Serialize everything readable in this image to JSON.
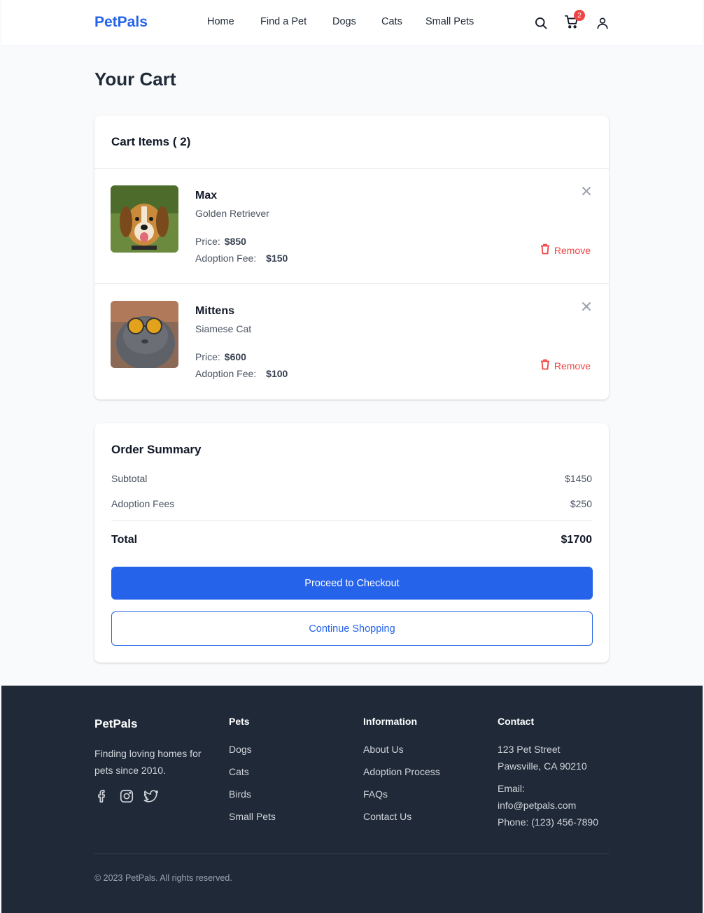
{
  "header": {
    "brand": "PetPals",
    "nav": [
      "Home",
      "Find a Pet",
      "Dogs",
      "Cats",
      "Small Pets"
    ],
    "cart_count": "2",
    "icons": [
      "search-icon",
      "cart-icon",
      "user-icon"
    ]
  },
  "page": {
    "title": "Your Cart"
  },
  "cart": {
    "heading": "Cart Items (  2)",
    "items": [
      {
        "name": "Max",
        "breed": "Golden Retriever",
        "price_label": "Price:",
        "price": "$850",
        "fee_label": "Adoption Fee:",
        "fee": "$150",
        "remove_label": "Remove"
      },
      {
        "name": "Mittens",
        "breed": "Siamese Cat",
        "price_label": "Price:",
        "price": "$600",
        "fee_label": "Adoption Fee:",
        "fee": "$100",
        "remove_label": "Remove"
      }
    ]
  },
  "summary": {
    "title": "Order Summary",
    "subtotal_label": "Subtotal",
    "subtotal": "$1450",
    "fees_label": "Adoption Fees",
    "fees": "$250",
    "total_label": "Total",
    "total": "$1700",
    "checkout_label": "Proceed to Checkout",
    "continue_label": "Continue Shopping"
  },
  "footer": {
    "brand": "PetPals",
    "tagline": "Finding loving homes for pets since 2010.",
    "social": [
      "facebook-icon",
      "instagram-icon",
      "twitter-icon"
    ],
    "pets_heading": "Pets",
    "pets_links": [
      "Dogs",
      "Cats",
      "Birds",
      "Small Pets"
    ],
    "info_heading": "Information",
    "info_links": [
      "About Us",
      "Adoption Process",
      "FAQs",
      "Contact Us"
    ],
    "contact_heading": "Contact",
    "address_line1": "123 Pet Street",
    "address_line2": "Pawsville, CA 90210",
    "email_label": "Email:",
    "email": "info@petpals.com",
    "phone": "Phone: (123) 456-7890",
    "copyright": "© 2023 PetPals. All rights reserved."
  },
  "colors": {
    "accent": "#2563eb",
    "danger": "#ef4444",
    "footer_bg": "#1f2937"
  }
}
